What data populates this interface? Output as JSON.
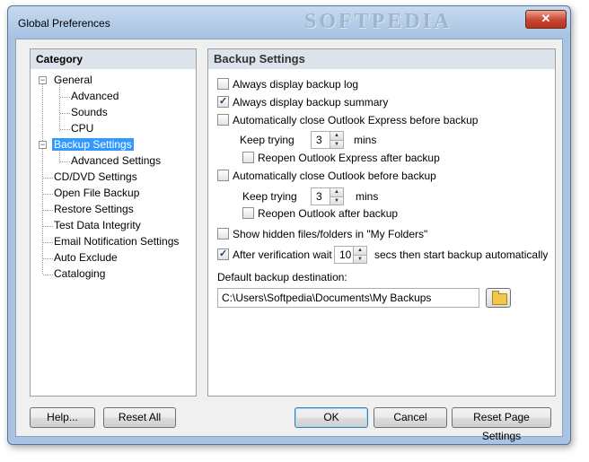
{
  "window": {
    "title": "Global Preferences",
    "watermark": "SOFTPEDIA",
    "close_glyph": "✕"
  },
  "category": {
    "header": "Category",
    "items": [
      {
        "label": "General",
        "level": 0,
        "expander": "−"
      },
      {
        "label": "Advanced",
        "level": 1
      },
      {
        "label": "Sounds",
        "level": 1
      },
      {
        "label": "CPU",
        "level": 1
      },
      {
        "label": "Backup Settings",
        "level": 0,
        "expander": "−",
        "selected": true
      },
      {
        "label": "Advanced Settings",
        "level": 1
      },
      {
        "label": "CD/DVD Settings",
        "level": 0
      },
      {
        "label": "Open File Backup",
        "level": 0
      },
      {
        "label": "Restore Settings",
        "level": 0
      },
      {
        "label": "Test Data Integrity",
        "level": 0
      },
      {
        "label": "Email Notification Settings",
        "level": 0
      },
      {
        "label": "Auto Exclude",
        "level": 0
      },
      {
        "label": "Cataloging",
        "level": 0
      }
    ]
  },
  "settings": {
    "header": "Backup Settings",
    "always_log": {
      "label": "Always display backup log",
      "checked": false
    },
    "always_summary": {
      "label": "Always display backup summary",
      "checked": true
    },
    "close_oe": {
      "label": "Automatically close Outlook Express before backup",
      "checked": false
    },
    "oe_keep_trying": {
      "label": "Keep trying",
      "value": "3",
      "unit": "mins"
    },
    "reopen_oe": {
      "label": "Reopen Outlook Express after backup",
      "checked": false
    },
    "close_outlook": {
      "label": "Automatically close Outlook before backup",
      "checked": false
    },
    "outlook_keep_trying": {
      "label": "Keep trying",
      "value": "3",
      "unit": "mins"
    },
    "reopen_outlook": {
      "label": "Reopen Outlook after backup",
      "checked": false
    },
    "show_hidden": {
      "label": "Show hidden files/folders in \"My Folders\"",
      "checked": false
    },
    "verification": {
      "label": "After verification wait",
      "checked": true,
      "value": "10",
      "suffix": "secs then start backup automatically"
    },
    "destination": {
      "label": "Default backup destination:",
      "value": "C:\\Users\\Softpedia\\Documents\\My Backups"
    }
  },
  "buttons": {
    "help": "Help...",
    "reset_all": "Reset All",
    "ok": "OK",
    "cancel": "Cancel",
    "reset_page": "Reset Page Settings"
  },
  "icons": {
    "spin_up": "▲",
    "spin_down": "▼",
    "check": "✓",
    "folder": "folder-icon"
  }
}
